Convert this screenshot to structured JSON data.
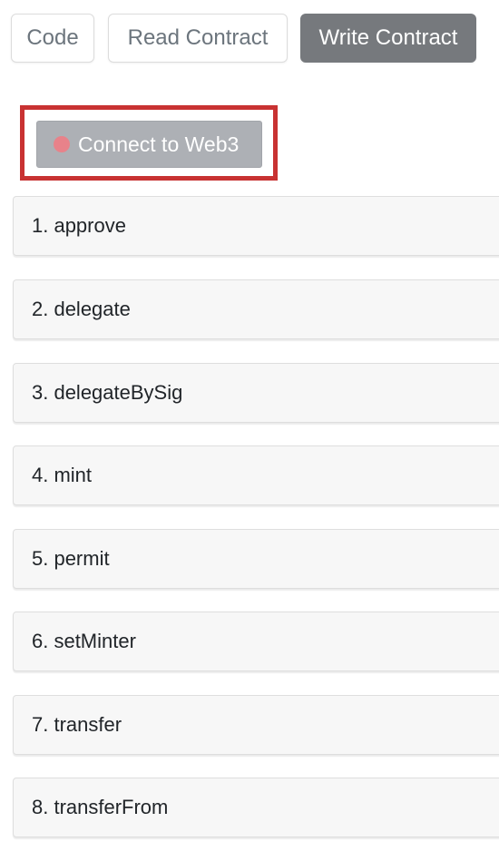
{
  "tabs": {
    "code_label": "Code",
    "read_label": "Read Contract",
    "write_label": "Write Contract",
    "active": "Write Contract"
  },
  "connect": {
    "label": "Connect to Web3",
    "status_color": "#e8828a",
    "highlight_color": "#c83232"
  },
  "functions": [
    "1. approve",
    "2. delegate",
    "3. delegateBySig",
    "4. mint",
    "5. permit",
    "6. setMinter",
    "7. transfer",
    "8. transferFrom"
  ]
}
